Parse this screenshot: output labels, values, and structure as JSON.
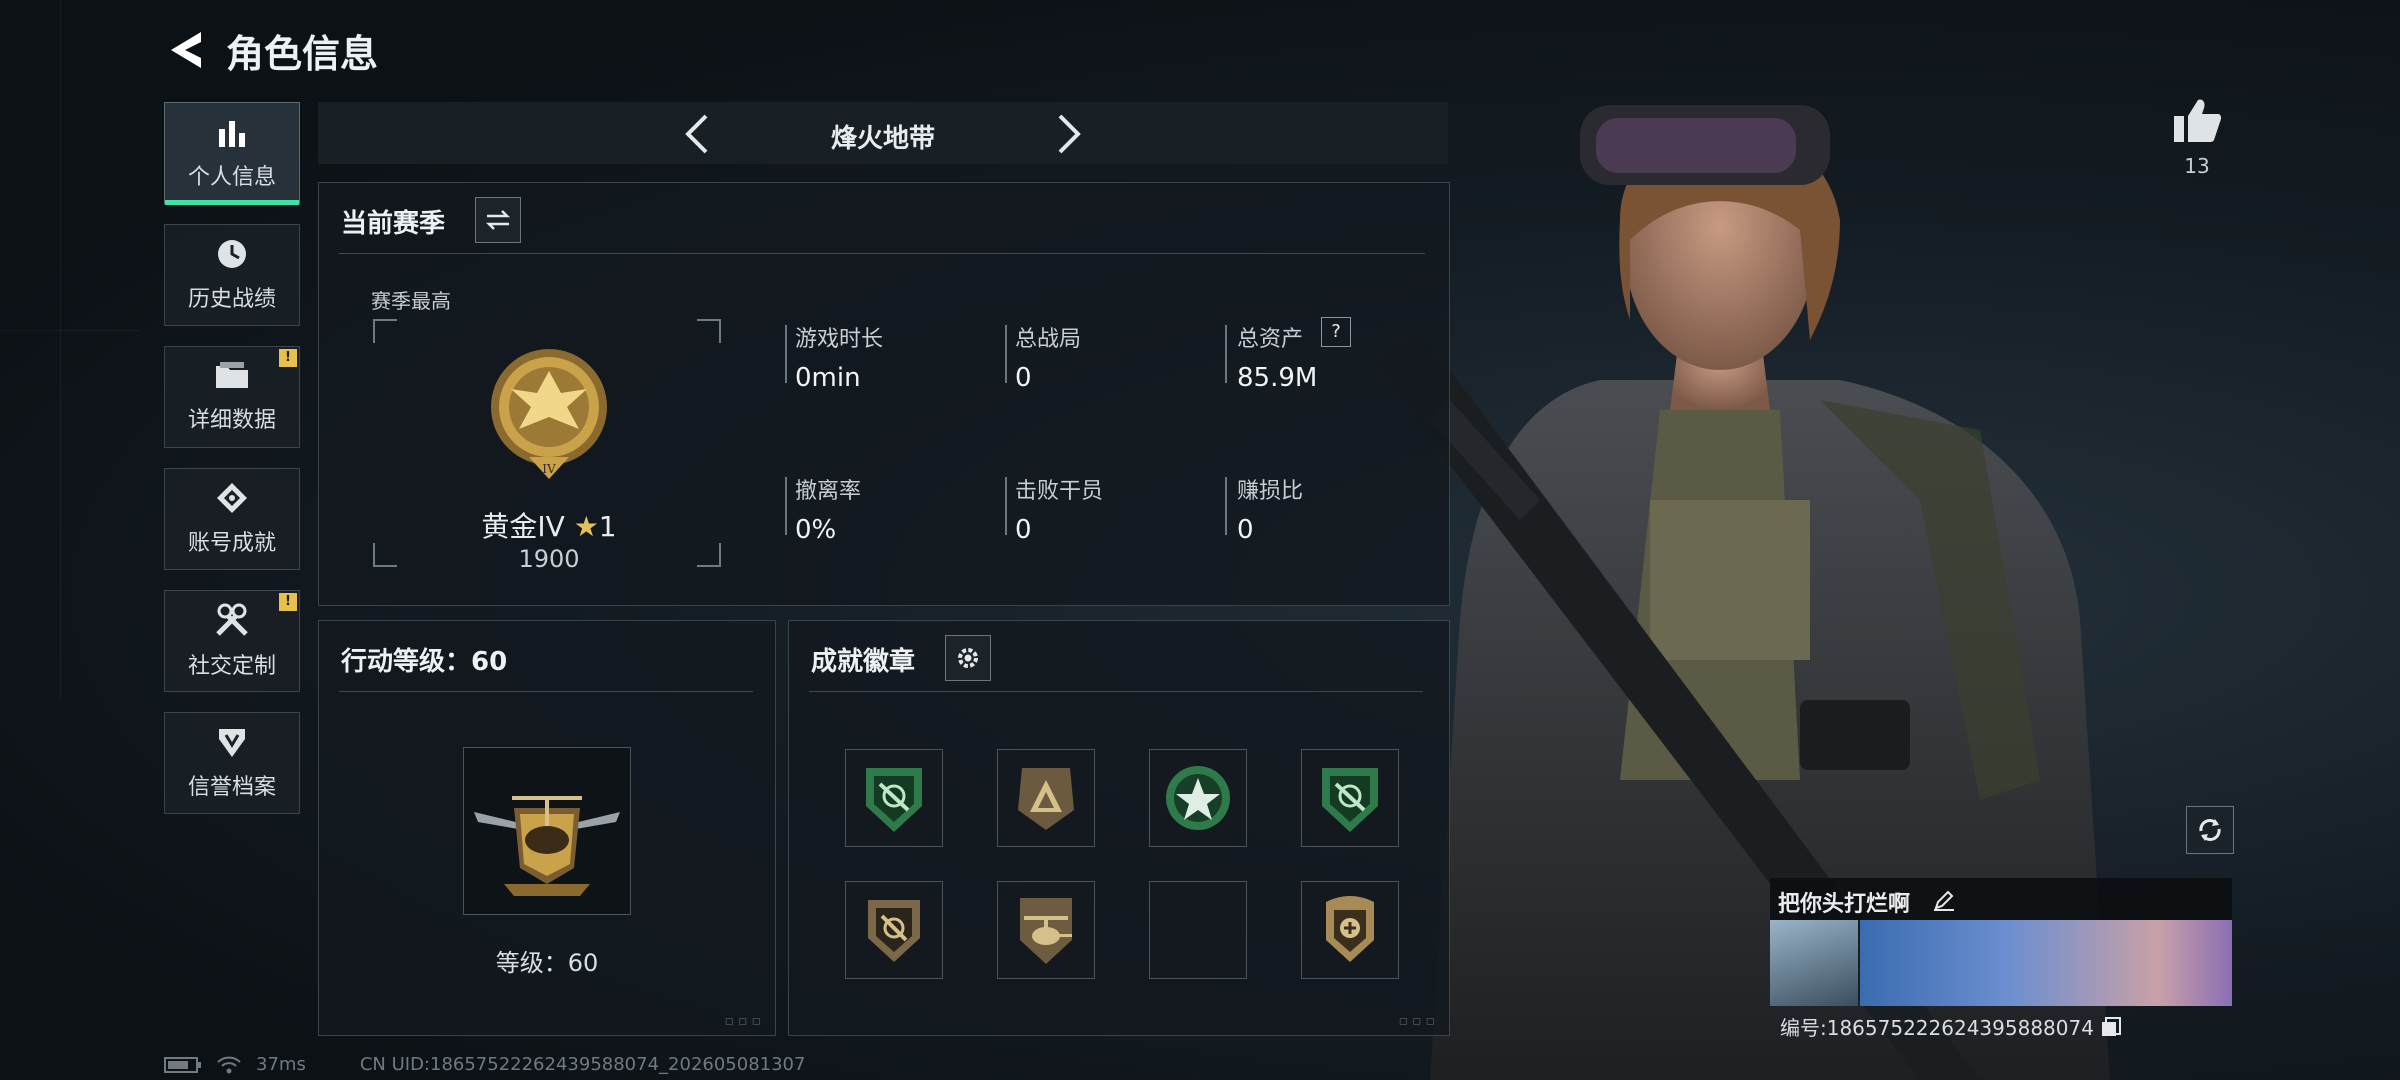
{
  "header": {
    "title": "角色信息"
  },
  "mode_selector": {
    "title": "烽火地带"
  },
  "sidebar": {
    "items": [
      {
        "label": "个人信息",
        "icon": "bar-chart-icon",
        "active": true
      },
      {
        "label": "历史战绩",
        "icon": "clock-icon"
      },
      {
        "label": "详细数据",
        "icon": "folder-icon",
        "badge": "!"
      },
      {
        "label": "账号成就",
        "icon": "achievement-icon"
      },
      {
        "label": "社交定制",
        "icon": "tools-icon",
        "badge": "!"
      },
      {
        "label": "信誉档案",
        "icon": "shield-icon"
      }
    ]
  },
  "season": {
    "title": "当前赛季",
    "peak_label": "赛季最高",
    "rank_name": "黄金IV",
    "rank_stars": "1",
    "rank_points": "1900",
    "stats": [
      {
        "label": "游戏时长",
        "value": "0min"
      },
      {
        "label": "总战局",
        "value": "0"
      },
      {
        "label": "总资产",
        "value": "85.9M",
        "help": "?"
      },
      {
        "label": "撤离率",
        "value": "0%"
      },
      {
        "label": "击败干员",
        "value": "0"
      },
      {
        "label": "赚损比",
        "value": "0"
      }
    ]
  },
  "action_level": {
    "title": "行动等级：60",
    "level_text": "等级：60"
  },
  "achievements": {
    "title": "成就徽章",
    "badges": [
      "green-shield-badge",
      "tan-triangle-badge",
      "green-star-badge",
      "green-shield-badge",
      "tan-shield-badge",
      "helicopter-badge",
      "empty-slot",
      "tan-crest-badge"
    ]
  },
  "likes": {
    "count": "13"
  },
  "player_card": {
    "name": "把你头打烂啊",
    "id_text": "编号:18657522262439588​8074"
  },
  "status_bar": {
    "ping": "37ms",
    "uid_text": "CN UID:1865752226243958​8074_202605081307"
  },
  "colors": {
    "accent": "#3fe3a7",
    "badge_yellow": "#e8c04c",
    "gold": "#c9a24a",
    "green_badge": "#2f7a4a"
  }
}
